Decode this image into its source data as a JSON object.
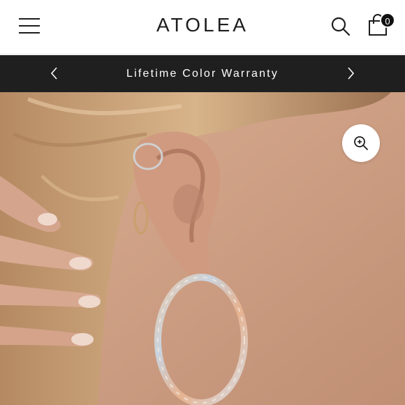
{
  "header": {
    "brand": "ATOLEA",
    "cart_count": "0"
  },
  "announcement": {
    "text": "Lifetime Color Warranty"
  },
  "icons": {
    "menu": "hamburger-menu-icon",
    "search": "search-icon",
    "cart": "shopping-bag-icon",
    "prev": "chevron-left-icon",
    "next": "chevron-right-icon",
    "zoom": "zoom-in-icon"
  },
  "colors": {
    "announcement_bg": "#1f1f1f",
    "text_dark": "#1d1d1d",
    "badge_bg": "#111111"
  }
}
